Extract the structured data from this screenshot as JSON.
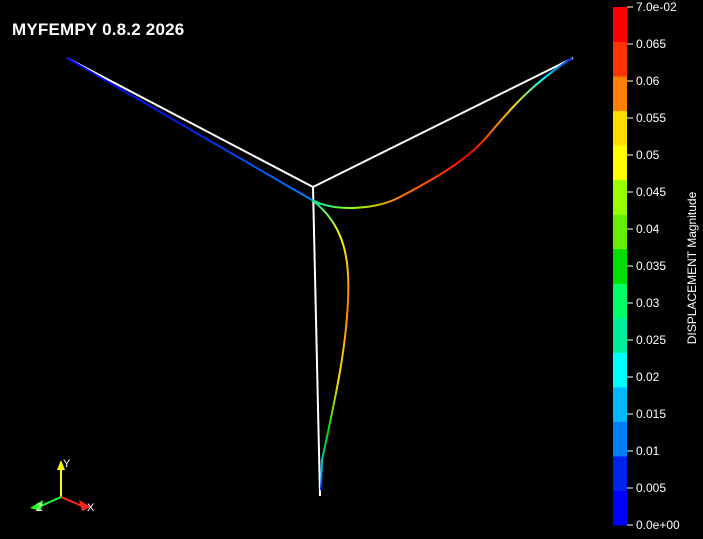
{
  "title": "MYFEMPY 0.8.2 2026",
  "colorbar": {
    "title": "DISPLACEMENT Magnitude",
    "min": 0.0,
    "max": 0.07,
    "tick_labels": [
      "0.0e+00",
      "0.005",
      "0.01",
      "0.015",
      "0.02",
      "0.025",
      "0.03",
      "0.035",
      "0.04",
      "0.045",
      "0.05",
      "0.055",
      "0.06",
      "0.065",
      "7.0e-02"
    ],
    "band_colors": [
      "#0000ff",
      "#0022ee",
      "#0080ff",
      "#00b8ff",
      "#00ffff",
      "#00ee99",
      "#00ff66",
      "#00dd00",
      "#66ee00",
      "#99ff00",
      "#ffff00",
      "#ffdd00",
      "#ff8000",
      "#ff3300",
      "#ff0000"
    ]
  },
  "axes_widget": {
    "x_label": "X",
    "y_label": "Y",
    "z_label": "Z",
    "x_color": "#ff2222",
    "y_color": "#ffff00",
    "z_color": "#22ff22"
  },
  "colors": {
    "undeformed": "#ffffff",
    "background": "#000000"
  }
}
